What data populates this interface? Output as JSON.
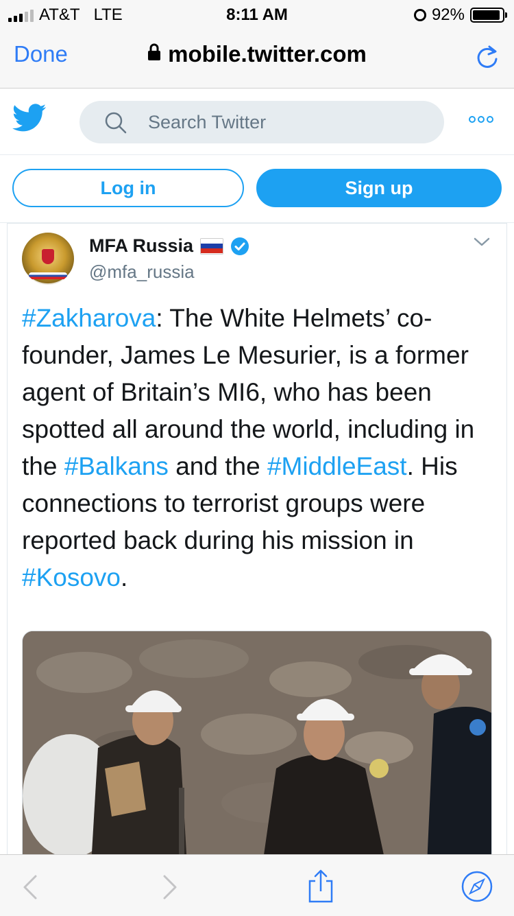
{
  "status_bar": {
    "carrier": "AT&T",
    "network": "LTE",
    "time": "8:11 AM",
    "battery": "92%",
    "battery_level": 0.92,
    "signal_bars_active": 3,
    "signal_bars_total": 5
  },
  "browser": {
    "done_label": "Done",
    "url": "mobile.twitter.com"
  },
  "twitter_header": {
    "search_placeholder": "Search Twitter",
    "accent_color": "#1da1f2"
  },
  "auth": {
    "login_label": "Log in",
    "signup_label": "Sign up"
  },
  "tweet": {
    "display_name": "MFA Russia",
    "handle": "@mfa_russia",
    "verified": true,
    "flag": "russia-flag",
    "text_segments": [
      {
        "text": "#Zakharova",
        "type": "hashtag"
      },
      {
        "text": ": The White Helmets’ co-founder, James Le Mesurier, is a former agent of Britain’s MI6, who has been spotted all around the world, including in the ",
        "type": "plain"
      },
      {
        "text": "#Balkans",
        "type": "hashtag"
      },
      {
        "text": " and the ",
        "type": "plain"
      },
      {
        "text": "#MiddleEast",
        "type": "hashtag"
      },
      {
        "text": ". His connections to terrorist groups were reported back during his mission in ",
        "type": "plain"
      },
      {
        "text": "#Kosovo",
        "type": "hashtag"
      },
      {
        "text": ".",
        "type": "plain"
      }
    ]
  },
  "bottom_toolbar": {
    "icons": [
      "back-icon",
      "forward-icon",
      "share-icon",
      "compass-icon"
    ],
    "tint": "#2f7cf6"
  }
}
